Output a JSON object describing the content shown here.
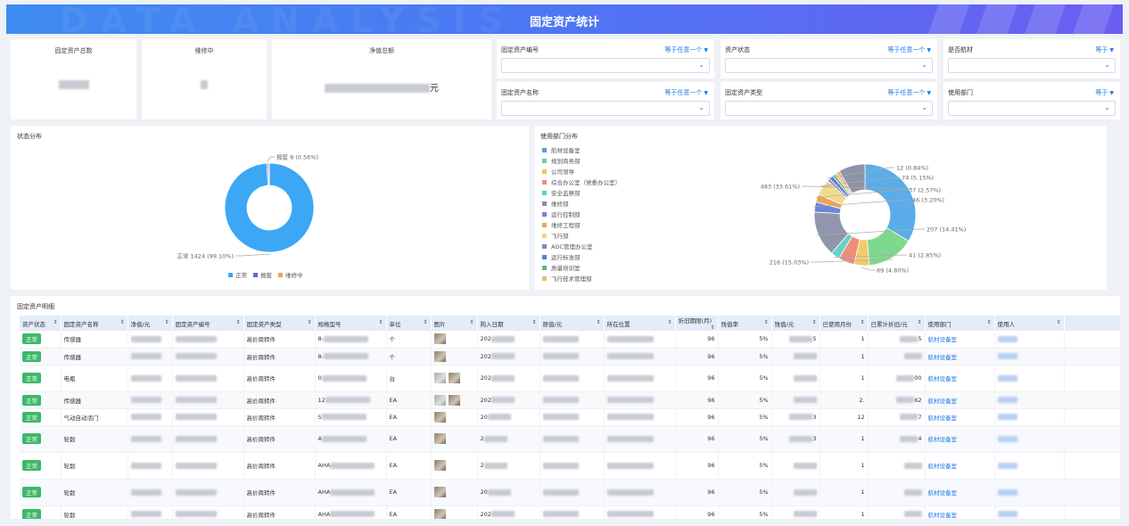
{
  "header": {
    "title": "固定资产统计",
    "watermark": "DATA ANALYSIS"
  },
  "stats": [
    {
      "label": "固定资产总数",
      "value_unit": ""
    },
    {
      "label": "维修中",
      "value_unit": ""
    },
    {
      "label": "净值总额",
      "value_unit": "元"
    }
  ],
  "filters": [
    {
      "label": "固定资产编号",
      "operator": "等于任意一个"
    },
    {
      "label": "资产状态",
      "operator": "等于任意一个"
    },
    {
      "label": "是否航材",
      "operator": "等于"
    },
    {
      "label": "固定资产名称",
      "operator": "等于任意一个"
    },
    {
      "label": "固定资产类型",
      "operator": "等于任意一个"
    },
    {
      "label": "使用部门",
      "operator": "等于"
    }
  ],
  "status_panel": {
    "title": "状态分布",
    "legend": [
      {
        "name": "正常",
        "color": "#3ba7f5"
      },
      {
        "name": "报废",
        "color": "#5470c6"
      },
      {
        "name": "维修中",
        "color": "#f0a35a"
      }
    ]
  },
  "dept_panel": {
    "title": "使用部门分布",
    "legend": [
      {
        "name": "航材设备室",
        "color": "#5b9bd5"
      },
      {
        "name": "规划商务部",
        "color": "#6fcf97"
      },
      {
        "name": "公司领导",
        "color": "#f2c55c"
      },
      {
        "name": "综合办公室（党委办公室）",
        "color": "#f08c7a"
      },
      {
        "name": "安全监察部",
        "color": "#5fd3c4"
      },
      {
        "name": "维修部",
        "color": "#8a8ea5"
      },
      {
        "name": "运行控制部",
        "color": "#6f86d6"
      },
      {
        "name": "维修工程部",
        "color": "#f0a35a"
      },
      {
        "name": "飞行部",
        "color": "#efd77a"
      },
      {
        "name": "AOC管理办公室",
        "color": "#7c86c9"
      },
      {
        "name": "运行标准部",
        "color": "#5c7fd1"
      },
      {
        "name": "质量培训室",
        "color": "#5db78a"
      },
      {
        "name": "飞行技术管理部",
        "color": "#e6c06d"
      }
    ]
  },
  "chart_data": [
    {
      "type": "pie",
      "variant": "donut",
      "title": "状态分布",
      "slices": [
        {
          "name": "正常",
          "value": 1424,
          "label": "正常 1424 (99.10%)",
          "color": "#3ba7f5"
        },
        {
          "name": "报废",
          "value": 8,
          "label": "报废 8 (0.56%)",
          "color": "#5470c6"
        },
        {
          "name": "维修中",
          "value": 5,
          "label": "",
          "color": "#f0a35a"
        }
      ]
    },
    {
      "type": "pie",
      "variant": "donut",
      "title": "使用部门分布",
      "slices": [
        {
          "value": 483,
          "label": "483 (33.61%)",
          "color": "#5aade8"
        },
        {
          "value": 216,
          "label": "216 (15.03%)",
          "color": "#7fd88e"
        },
        {
          "value": 69,
          "label": "69 (4.80%)",
          "color": "#f2cb6a"
        },
        {
          "value": 74,
          "label": "",
          "color": "#f08c7a"
        },
        {
          "value": 41,
          "label": "41 (2.85%)",
          "color": "#69d1c5"
        },
        {
          "value": 207,
          "label": "207 (14.41%)",
          "color": "#9097ad"
        },
        {
          "value": 46,
          "label": "46 (3.20%)",
          "color": "#6f86d6"
        },
        {
          "value": 37,
          "label": "37 (2.57%)",
          "color": "#f0a35a"
        },
        {
          "value": 74,
          "label": "74 (5.15%)",
          "color": "#efdb8a"
        },
        {
          "value": 12,
          "label": "12 (0.84%)",
          "color": "#8189c9"
        },
        {
          "value": 20,
          "label": "",
          "color": "#5c7fd1"
        },
        {
          "value": 12,
          "label": "",
          "color": "#5db78a"
        },
        {
          "value": 12,
          "label": "",
          "color": "#e6c06d"
        },
        {
          "value": 12,
          "label": "",
          "color": "#f39c87"
        },
        {
          "value": 122,
          "label": "",
          "color": "#8f93a8"
        }
      ]
    }
  ],
  "table": {
    "title": "固定资产明细",
    "columns": [
      "资产状态",
      "固定资产名称",
      "净值/元",
      "固定资产编号",
      "固定资产类型",
      "规格型号",
      "单位",
      "图片",
      "购入日期",
      "原值/元",
      "所在位置",
      "折旧期限(月)",
      "残值率",
      "残值/元",
      "已使用月份",
      "已累计折旧/元",
      "使用部门",
      "使用人"
    ],
    "rows": [
      {
        "status": "正常",
        "name": "传感器",
        "type": "高价周转件",
        "spec": "8-",
        "unit": "个",
        "date": "202",
        "period": "96",
        "rate": "5%",
        "residual_tail": "5",
        "used": "1",
        "dep_tail": "5",
        "dept": "航材设备室"
      },
      {
        "status": "正常",
        "name": "传感器",
        "type": "高价周转件",
        "spec": "8-",
        "unit": "个",
        "date": "202",
        "period": "96",
        "rate": "5%",
        "residual_tail": "",
        "used": "1",
        "dep_tail": "",
        "dept": "航材设备室"
      },
      {
        "status": "正常",
        "name": "电瓶",
        "type": "高价周转件",
        "spec": "0",
        "unit": "台",
        "date": "202",
        "period": "96",
        "rate": "5%",
        "residual_tail": "",
        "used": "1",
        "dep_tail": "00",
        "dept": "航材设备室"
      },
      {
        "status": "正常",
        "name": "传感器",
        "type": "高价周转件",
        "spec": "12",
        "unit": "EA",
        "date": "202",
        "period": "96",
        "rate": "5%",
        "residual_tail": "",
        "used": "2.",
        "dep_tail": "62",
        "dept": "航材设备室"
      },
      {
        "status": "正常",
        "name": "气动自动活门",
        "type": "高价周转件",
        "spec": "5",
        "unit": "EA",
        "date": "20",
        "period": "96",
        "rate": "5%",
        "residual_tail": "3",
        "used": "12",
        "dep_tail": "7",
        "dept": "航材设备室"
      },
      {
        "status": "正常",
        "name": "轮毂",
        "type": "高价周转件",
        "spec": "A",
        "unit": "EA",
        "date": "2",
        "period": "96",
        "rate": "5%",
        "residual_tail": "3",
        "used": "1",
        "dep_tail": "4",
        "dept": "航材设备室"
      },
      {
        "status": "正常",
        "name": "轮毂",
        "type": "高价周转件",
        "spec": "AHA",
        "unit": "EA",
        "date": "2",
        "period": "96",
        "rate": "5%",
        "residual_tail": "",
        "used": "1",
        "dep_tail": "",
        "dept": "航材设备室"
      },
      {
        "status": "正常",
        "name": "轮毂",
        "type": "高价周转件",
        "spec": "AHA",
        "unit": "EA",
        "date": "20",
        "period": "96",
        "rate": "5%",
        "residual_tail": "",
        "used": "1",
        "dep_tail": "",
        "dept": "航材设备室"
      },
      {
        "status": "正常",
        "name": "轮毂",
        "type": "高价周转件",
        "spec": "AHA",
        "unit": "EA",
        "date": "202",
        "period": "96",
        "rate": "5%",
        "residual_tail": "",
        "used": "1",
        "dep_tail": "",
        "dept": "航材设备室"
      }
    ]
  }
}
